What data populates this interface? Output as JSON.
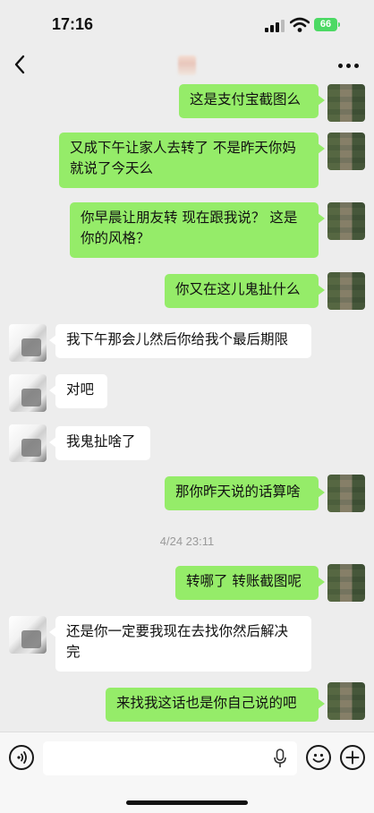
{
  "status_bar": {
    "time": "17:16",
    "battery": "66"
  },
  "nav": {
    "back_icon": "chevron-left-icon",
    "more_icon": "more-horizontal-icon"
  },
  "messages": [
    {
      "sender": "me",
      "lines": [
        "这是支付宝截图么"
      ]
    },
    {
      "sender": "me",
      "lines": [
        "又成下午让家人去转了 不是昨天你妈",
        "就说了今天么"
      ]
    },
    {
      "sender": "me",
      "lines": [
        "你早晨让朋友转 现在跟我说？ 这是",
        "你的风格？"
      ]
    },
    {
      "sender": "me",
      "lines": [
        "你又在这儿鬼扯什么"
      ]
    },
    {
      "sender": "them",
      "lines": [
        "我下午那会儿然后你给我个最后期限"
      ]
    },
    {
      "sender": "them",
      "lines": [
        "对吧"
      ]
    },
    {
      "sender": "them",
      "lines": [
        "我鬼扯啥了"
      ]
    },
    {
      "sender": "me",
      "lines": [
        "那你昨天说的话算啥"
      ]
    },
    {
      "sender": "me",
      "lines": [
        "转哪了 转账截图呢"
      ]
    },
    {
      "sender": "them",
      "lines": [
        "还是你一定要我现在去找你然后解决",
        "完"
      ]
    },
    {
      "sender": "me",
      "lines": [
        "来找我这话也是你自己说的吧"
      ]
    }
  ],
  "timestamp": "4/24 23:11",
  "input_bar": {
    "voice_icon": "voice-icon",
    "mic_icon": "microphone-icon",
    "emoji_icon": "emoji-icon",
    "plus_icon": "plus-icon",
    "placeholder": ""
  },
  "colors": {
    "me_bubble": "#95ec69",
    "them_bubble": "#ffffff",
    "background": "#ededed"
  }
}
